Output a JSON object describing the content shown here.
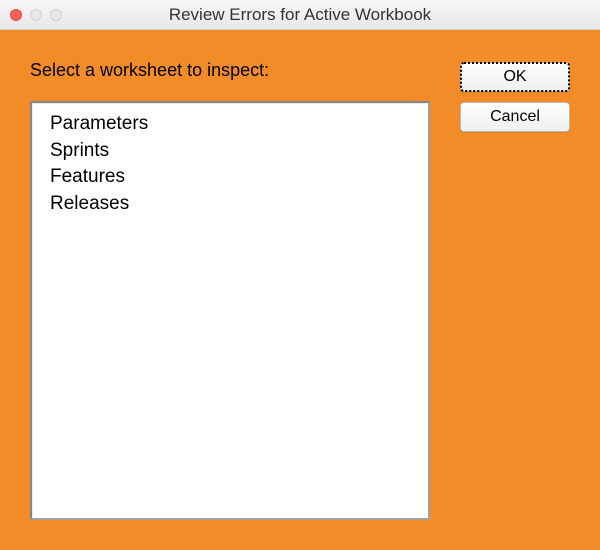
{
  "window": {
    "title": "Review Errors for Active Workbook"
  },
  "dialog": {
    "prompt": "Select a worksheet to inspect:",
    "worksheets": [
      {
        "label": "Parameters"
      },
      {
        "label": "Sprints"
      },
      {
        "label": "Features"
      },
      {
        "label": "Releases"
      }
    ]
  },
  "buttons": {
    "ok": "OK",
    "cancel": "Cancel"
  }
}
